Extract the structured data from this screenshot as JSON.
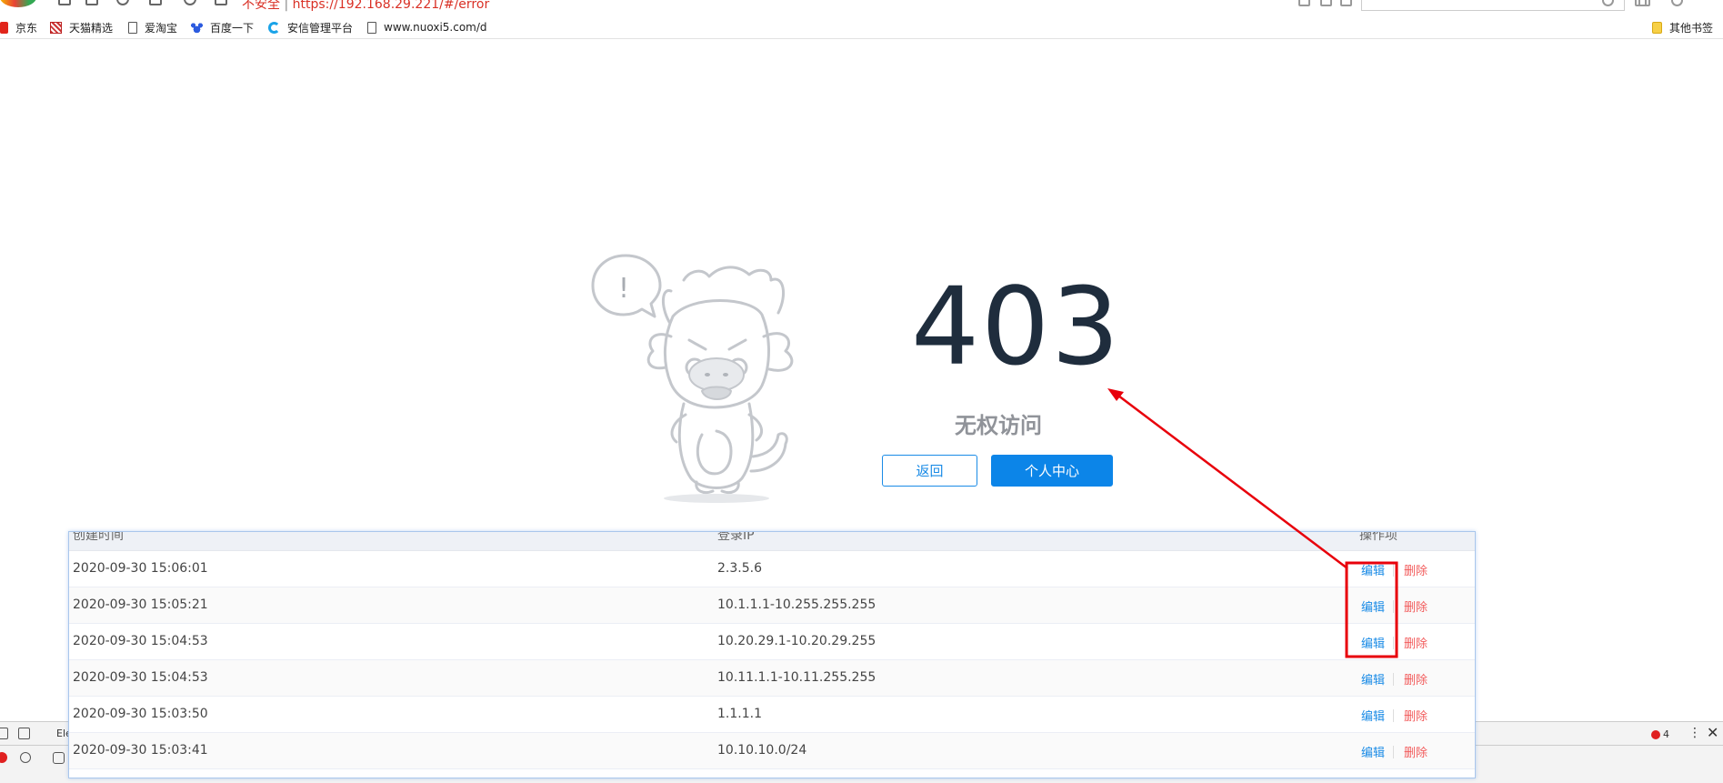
{
  "browser": {
    "address": "https://192.168.29.221/#/error",
    "address_prefix": "不安全"
  },
  "bookmarks": [
    {
      "label": "京东",
      "icon": "jd-icon"
    },
    {
      "label": "天猫精选",
      "icon": "tmall-icon"
    },
    {
      "label": "爱淘宝",
      "icon": "page-icon"
    },
    {
      "label": "百度一下",
      "icon": "baidu-icon"
    },
    {
      "label": "安信管理平台",
      "icon": "anxin-icon"
    },
    {
      "label": "www.nuoxi5.com/d",
      "icon": "page-icon"
    }
  ],
  "other_bookmarks": "其他书签",
  "error": {
    "code": "403",
    "message": "无权访问",
    "back_label": "返回",
    "user_center_label": "个人中心"
  },
  "table": {
    "headers": {
      "time": "创建时间",
      "ip": "登录IP",
      "actions": "操作项"
    },
    "rows": [
      {
        "time": "2020-09-30 15:06:01",
        "ip": "2.3.5.6",
        "edit": "编辑",
        "delete": "删除"
      },
      {
        "time": "2020-09-30 15:05:21",
        "ip": "10.1.1.1-10.255.255.255",
        "edit": "编辑",
        "delete": "删除"
      },
      {
        "time": "2020-09-30 15:04:53",
        "ip": "10.20.29.1-10.20.29.255",
        "edit": "编辑",
        "delete": "删除"
      },
      {
        "time": "2020-09-30 15:04:53",
        "ip": "10.11.1.1-10.11.255.255",
        "edit": "编辑",
        "delete": "删除"
      },
      {
        "time": "2020-09-30 15:03:50",
        "ip": "1.1.1.1",
        "edit": "编辑",
        "delete": "删除"
      },
      {
        "time": "2020-09-30 15:03:41",
        "ip": "10.10.10.0/24",
        "edit": "编辑",
        "delete": "删除"
      }
    ]
  },
  "devtools": {
    "tab_label": "Ele",
    "error_count": "4"
  },
  "colors": {
    "primary": "#0c85e8",
    "danger": "#f25b5b",
    "annotation": "#e8000b",
    "code_text": "#1f2d3d"
  }
}
